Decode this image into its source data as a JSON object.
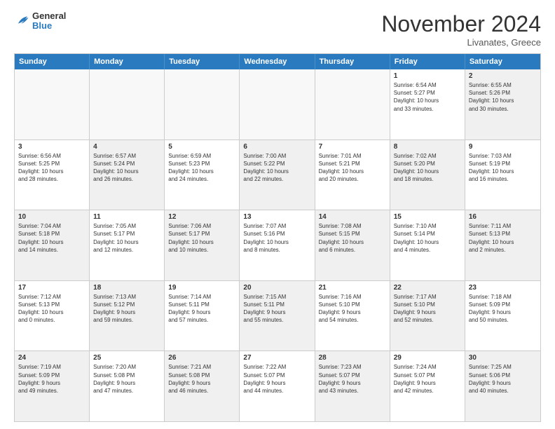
{
  "header": {
    "logo_general": "General",
    "logo_blue": "Blue",
    "month_title": "November 2024",
    "subtitle": "Livanates, Greece"
  },
  "weekdays": [
    "Sunday",
    "Monday",
    "Tuesday",
    "Wednesday",
    "Thursday",
    "Friday",
    "Saturday"
  ],
  "rows": [
    [
      {
        "day": "",
        "info": "",
        "empty": true
      },
      {
        "day": "",
        "info": "",
        "empty": true
      },
      {
        "day": "",
        "info": "",
        "empty": true
      },
      {
        "day": "",
        "info": "",
        "empty": true
      },
      {
        "day": "",
        "info": "",
        "empty": true
      },
      {
        "day": "1",
        "info": "Sunrise: 6:54 AM\nSunset: 5:27 PM\nDaylight: 10 hours\nand 33 minutes.",
        "empty": false
      },
      {
        "day": "2",
        "info": "Sunrise: 6:55 AM\nSunset: 5:26 PM\nDaylight: 10 hours\nand 30 minutes.",
        "empty": false,
        "shaded": true
      }
    ],
    [
      {
        "day": "3",
        "info": "Sunrise: 6:56 AM\nSunset: 5:25 PM\nDaylight: 10 hours\nand 28 minutes.",
        "empty": false
      },
      {
        "day": "4",
        "info": "Sunrise: 6:57 AM\nSunset: 5:24 PM\nDaylight: 10 hours\nand 26 minutes.",
        "empty": false,
        "shaded": true
      },
      {
        "day": "5",
        "info": "Sunrise: 6:59 AM\nSunset: 5:23 PM\nDaylight: 10 hours\nand 24 minutes.",
        "empty": false
      },
      {
        "day": "6",
        "info": "Sunrise: 7:00 AM\nSunset: 5:22 PM\nDaylight: 10 hours\nand 22 minutes.",
        "empty": false,
        "shaded": true
      },
      {
        "day": "7",
        "info": "Sunrise: 7:01 AM\nSunset: 5:21 PM\nDaylight: 10 hours\nand 20 minutes.",
        "empty": false
      },
      {
        "day": "8",
        "info": "Sunrise: 7:02 AM\nSunset: 5:20 PM\nDaylight: 10 hours\nand 18 minutes.",
        "empty": false,
        "shaded": true
      },
      {
        "day": "9",
        "info": "Sunrise: 7:03 AM\nSunset: 5:19 PM\nDaylight: 10 hours\nand 16 minutes.",
        "empty": false
      }
    ],
    [
      {
        "day": "10",
        "info": "Sunrise: 7:04 AM\nSunset: 5:18 PM\nDaylight: 10 hours\nand 14 minutes.",
        "empty": false,
        "shaded": true
      },
      {
        "day": "11",
        "info": "Sunrise: 7:05 AM\nSunset: 5:17 PM\nDaylight: 10 hours\nand 12 minutes.",
        "empty": false
      },
      {
        "day": "12",
        "info": "Sunrise: 7:06 AM\nSunset: 5:17 PM\nDaylight: 10 hours\nand 10 minutes.",
        "empty": false,
        "shaded": true
      },
      {
        "day": "13",
        "info": "Sunrise: 7:07 AM\nSunset: 5:16 PM\nDaylight: 10 hours\nand 8 minutes.",
        "empty": false
      },
      {
        "day": "14",
        "info": "Sunrise: 7:08 AM\nSunset: 5:15 PM\nDaylight: 10 hours\nand 6 minutes.",
        "empty": false,
        "shaded": true
      },
      {
        "day": "15",
        "info": "Sunrise: 7:10 AM\nSunset: 5:14 PM\nDaylight: 10 hours\nand 4 minutes.",
        "empty": false
      },
      {
        "day": "16",
        "info": "Sunrise: 7:11 AM\nSunset: 5:13 PM\nDaylight: 10 hours\nand 2 minutes.",
        "empty": false,
        "shaded": true
      }
    ],
    [
      {
        "day": "17",
        "info": "Sunrise: 7:12 AM\nSunset: 5:13 PM\nDaylight: 10 hours\nand 0 minutes.",
        "empty": false
      },
      {
        "day": "18",
        "info": "Sunrise: 7:13 AM\nSunset: 5:12 PM\nDaylight: 9 hours\nand 59 minutes.",
        "empty": false,
        "shaded": true
      },
      {
        "day": "19",
        "info": "Sunrise: 7:14 AM\nSunset: 5:11 PM\nDaylight: 9 hours\nand 57 minutes.",
        "empty": false
      },
      {
        "day": "20",
        "info": "Sunrise: 7:15 AM\nSunset: 5:11 PM\nDaylight: 9 hours\nand 55 minutes.",
        "empty": false,
        "shaded": true
      },
      {
        "day": "21",
        "info": "Sunrise: 7:16 AM\nSunset: 5:10 PM\nDaylight: 9 hours\nand 54 minutes.",
        "empty": false
      },
      {
        "day": "22",
        "info": "Sunrise: 7:17 AM\nSunset: 5:10 PM\nDaylight: 9 hours\nand 52 minutes.",
        "empty": false,
        "shaded": true
      },
      {
        "day": "23",
        "info": "Sunrise: 7:18 AM\nSunset: 5:09 PM\nDaylight: 9 hours\nand 50 minutes.",
        "empty": false
      }
    ],
    [
      {
        "day": "24",
        "info": "Sunrise: 7:19 AM\nSunset: 5:09 PM\nDaylight: 9 hours\nand 49 minutes.",
        "empty": false,
        "shaded": true
      },
      {
        "day": "25",
        "info": "Sunrise: 7:20 AM\nSunset: 5:08 PM\nDaylight: 9 hours\nand 47 minutes.",
        "empty": false
      },
      {
        "day": "26",
        "info": "Sunrise: 7:21 AM\nSunset: 5:08 PM\nDaylight: 9 hours\nand 46 minutes.",
        "empty": false,
        "shaded": true
      },
      {
        "day": "27",
        "info": "Sunrise: 7:22 AM\nSunset: 5:07 PM\nDaylight: 9 hours\nand 44 minutes.",
        "empty": false
      },
      {
        "day": "28",
        "info": "Sunrise: 7:23 AM\nSunset: 5:07 PM\nDaylight: 9 hours\nand 43 minutes.",
        "empty": false,
        "shaded": true
      },
      {
        "day": "29",
        "info": "Sunrise: 7:24 AM\nSunset: 5:07 PM\nDaylight: 9 hours\nand 42 minutes.",
        "empty": false
      },
      {
        "day": "30",
        "info": "Sunrise: 7:25 AM\nSunset: 5:06 PM\nDaylight: 9 hours\nand 40 minutes.",
        "empty": false,
        "shaded": true
      }
    ]
  ]
}
